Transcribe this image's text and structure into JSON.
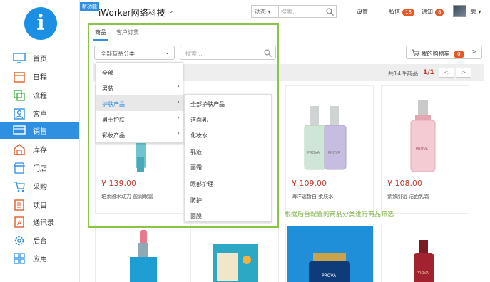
{
  "sidebar": {
    "logo_letter": "i",
    "items": [
      {
        "label": "首页",
        "icon": "monitor-icon"
      },
      {
        "label": "日程",
        "icon": "calendar-icon"
      },
      {
        "label": "流程",
        "icon": "flow-icon"
      },
      {
        "label": "客户",
        "icon": "customer-icon"
      },
      {
        "label": "销售",
        "icon": "sales-icon"
      },
      {
        "label": "库存",
        "icon": "warehouse-icon"
      },
      {
        "label": "门店",
        "icon": "store-icon"
      },
      {
        "label": "采购",
        "icon": "cart-icon"
      },
      {
        "label": "项目",
        "icon": "project-icon"
      },
      {
        "label": "通讯录",
        "icon": "contacts-icon"
      },
      {
        "label": "后台",
        "icon": "gear-icon"
      },
      {
        "label": "应用",
        "icon": "apps-icon"
      }
    ],
    "active_index": 4
  },
  "topbar": {
    "new_badge": "新功能",
    "company": "iWorker网络科技",
    "dyn_select": "动态",
    "search_placeholder": "搜索...",
    "settings": "设置",
    "messages": "私信",
    "messages_count": "18",
    "notices": "通知",
    "notices_count": "8",
    "user": "郭"
  },
  "tabs": [
    "商品",
    "客户订货"
  ],
  "filter": {
    "category_select": "全部商品分类",
    "search_placeholder": "搜索...",
    "cart_label": "我的购物车",
    "cart_count": "0"
  },
  "results": {
    "summary": "共14件商品",
    "page": "1/1",
    "prev": "<",
    "next": ">"
  },
  "dropdown_level1": [
    {
      "label": "全部",
      "has_sub": false
    },
    {
      "label": "男装",
      "has_sub": true
    },
    {
      "label": "护肤产品",
      "has_sub": true
    },
    {
      "label": "男士护肤",
      "has_sub": true
    },
    {
      "label": "彩妆产品",
      "has_sub": true
    }
  ],
  "dropdown_level2": [
    "全部护肤产品",
    "洁面乳",
    "化妆水",
    "乳液",
    "面霜",
    "眼部护理",
    "防护",
    "面膜"
  ],
  "products": [
    {
      "price": "¥ 139.00",
      "name": "珀莱雅水动力 盈润眼霜"
    },
    {
      "price": "¥ 109.00",
      "name": "海洋透皙白 柔肤水"
    },
    {
      "price": "¥ 108.00",
      "name": "紫致肌密 洁面乳霜"
    }
  ],
  "product_brand": "PROVA",
  "annotation": "根据后台配置的商品分类进行商品筛选",
  "colors": {
    "accent": "#2f8fe0",
    "price": "#c0392b",
    "annotation": "#7cb342",
    "badge": "#e05a2a"
  }
}
